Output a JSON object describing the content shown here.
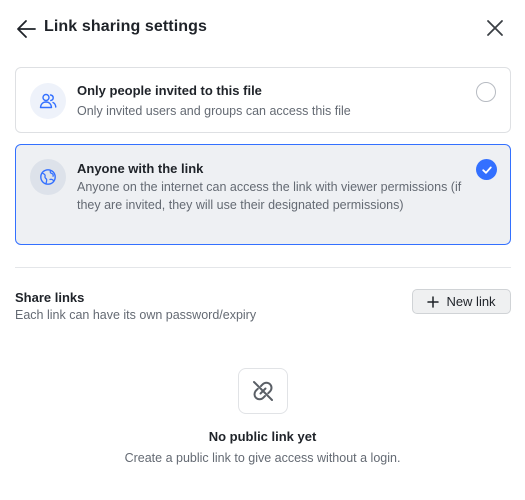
{
  "header": {
    "title": "Link sharing settings",
    "back_icon": "arrow-left-icon",
    "close_icon": "close-icon"
  },
  "options": [
    {
      "title": "Only people invited to this file",
      "description": "Only invited users and groups can access this file",
      "icon": "users-icon",
      "selected": false
    },
    {
      "title": "Anyone with the link",
      "description": "Anyone on the internet can access the link with viewer permissions (if they are invited, they will use their designated permissions)",
      "icon": "globe-icon",
      "selected": true
    }
  ],
  "share_links": {
    "title": "Share links",
    "subtitle": "Each link can have its own password/expiry",
    "new_link_label": "New link"
  },
  "empty_state": {
    "icon": "broken-link-icon",
    "title": "No public link yet",
    "subtitle": "Create a public link to give access without a login."
  },
  "colors": {
    "accent": "#3370ff",
    "text_primary": "#1f2329",
    "text_secondary": "#646a73",
    "border": "#dee0e3",
    "selected_bg": "#eef0f3"
  }
}
